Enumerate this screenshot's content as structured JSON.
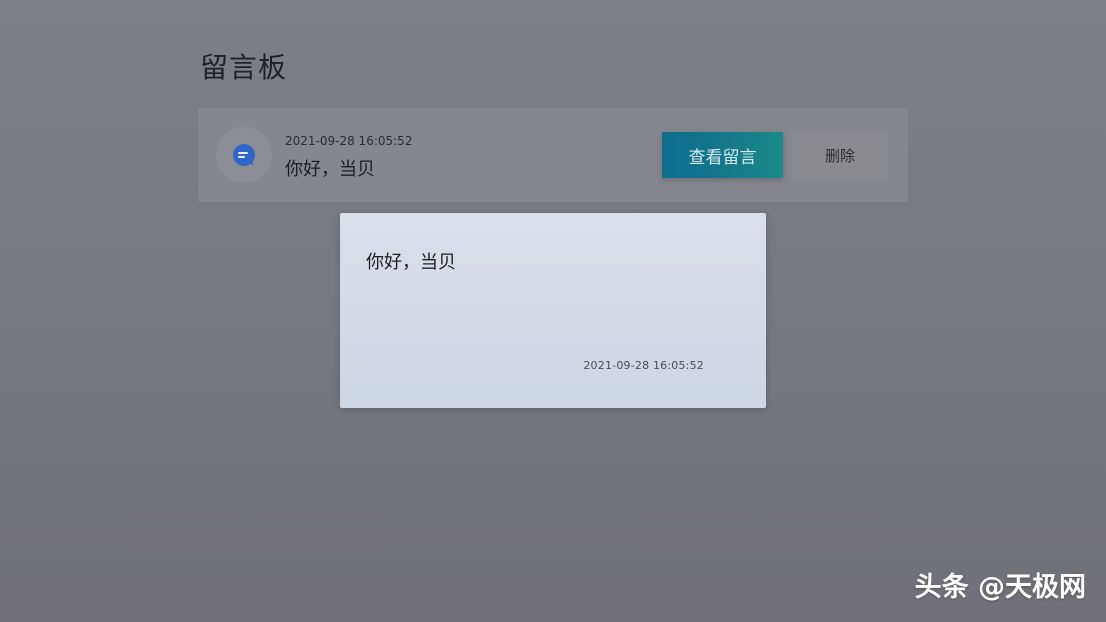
{
  "page": {
    "title": "留言板"
  },
  "message_list": {
    "items": [
      {
        "avatar_icon": "chat-bubble-icon",
        "time": "2021-09-28 16:05:52",
        "text": "你好，当贝",
        "view_label": "查看留言",
        "delete_label": "删除"
      }
    ]
  },
  "dialog": {
    "text": "你好，当贝",
    "time": "2021-09-28 16:05:52"
  },
  "watermark": {
    "text": "头条 @天极网"
  },
  "colors": {
    "accent": "#15788b",
    "accent_end": "#1b8a88",
    "background": "#777a82",
    "modal_bg": "#d4dbe6"
  }
}
